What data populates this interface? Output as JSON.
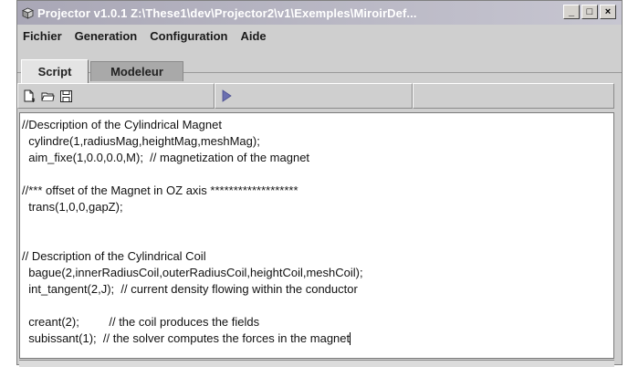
{
  "window": {
    "title": "Projector v1.0.1 Z:\\These1\\dev\\Projector2\\v1\\Exemples\\MiroirDef...",
    "buttons": {
      "minimize": "_",
      "maximize": "□",
      "close": "×"
    }
  },
  "menu": {
    "items": [
      "Fichier",
      "Generation",
      "Configuration",
      "Aide"
    ]
  },
  "tabs": [
    {
      "label": "Script",
      "active": true
    },
    {
      "label": "Modeleur",
      "active": false
    }
  ],
  "toolbar": {
    "icons": [
      "new-file-icon",
      "open-folder-icon",
      "save-icon",
      "run-icon"
    ]
  },
  "editor": {
    "lines": [
      "//Description of the Cylindrical Magnet",
      "  cylindre(1,radiusMag,heightMag,meshMag);",
      "  aim_fixe(1,0.0,0.0,M);  // magnetization of the magnet",
      "",
      "//*** offset of the Magnet in OZ axis *******************",
      "  trans(1,0,0,gapZ);",
      "",
      "",
      "// Description of the Cylindrical Coil",
      "  bague(2,innerRadiusCoil,outerRadiusCoil,heightCoil,meshCoil);",
      "  int_tangent(2,J);  // current density flowing within the conductor",
      "",
      "  creant(2);         // the coil produces the fields",
      "  subissant(1);  // the solver computes the forces in the magnet"
    ]
  }
}
